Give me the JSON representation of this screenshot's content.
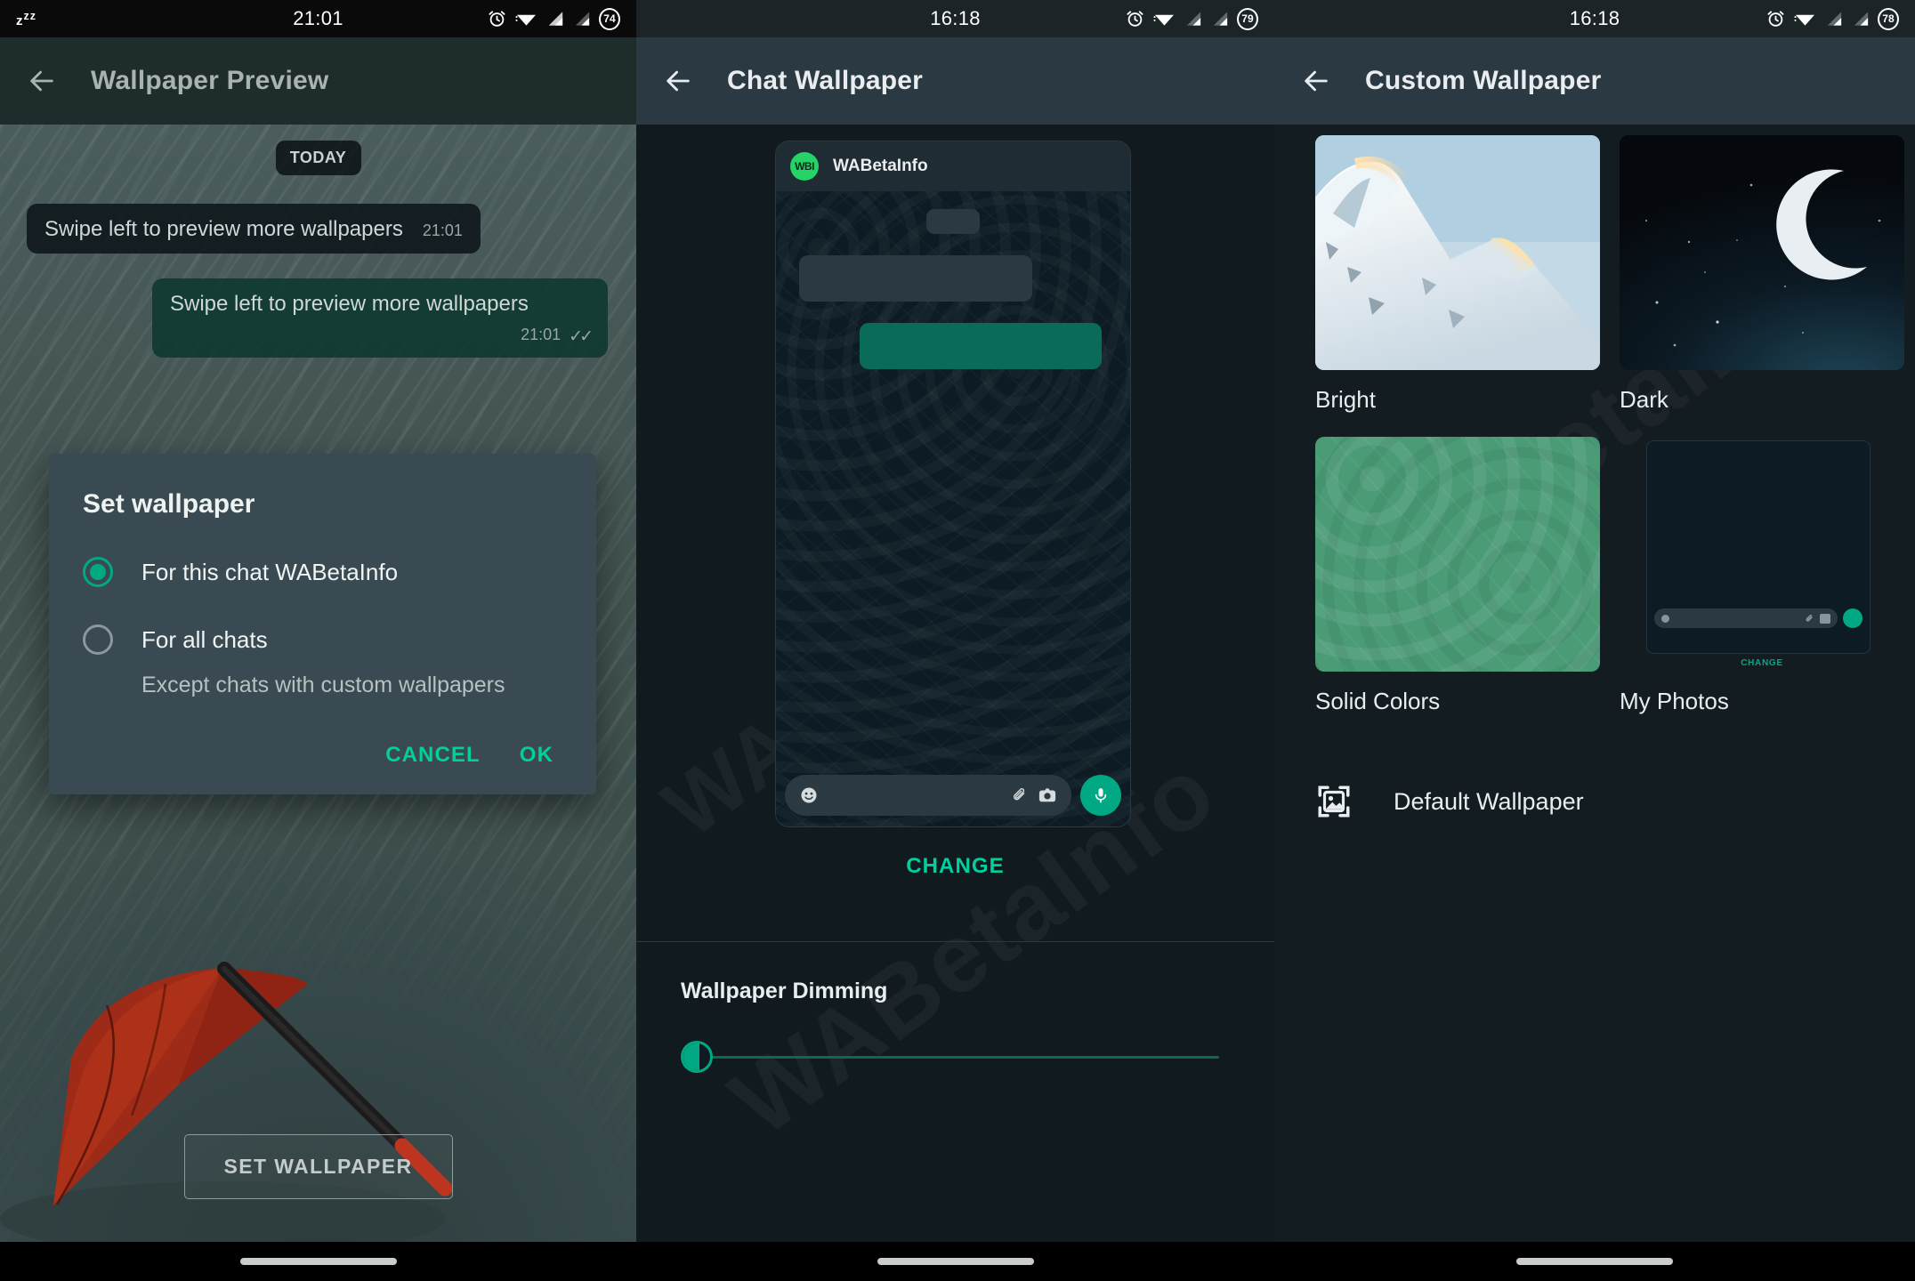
{
  "panels": [
    {
      "id": "wallpaper-preview",
      "statusbar": {
        "sleep_icon": "zzz-icon",
        "time": "21:01",
        "alarm_icon": "alarm-icon",
        "wifi_icon": "wifi-icon",
        "signal1_icon": "signal-icon",
        "signal2_icon": "signal-icon",
        "battery": "74"
      },
      "appbar": {
        "back_icon": "back-arrow-icon",
        "title": "Wallpaper Preview"
      },
      "chat": {
        "date_pill": "TODAY",
        "messages": [
          {
            "text": "Swipe left to preview more wallpapers",
            "time": "21:01",
            "direction": "incoming",
            "ticks": ""
          },
          {
            "text": "Swipe left to preview more wallpapers",
            "time": "21:01",
            "direction": "outgoing",
            "ticks": "✓✓"
          }
        ]
      },
      "dialog": {
        "title": "Set wallpaper",
        "options": [
          {
            "label": "For this chat WABetaInfo",
            "selected": true,
            "sub": ""
          },
          {
            "label": "For all chats",
            "selected": false,
            "sub": "Except chats with custom wallpapers"
          }
        ],
        "cancel_label": "CANCEL",
        "ok_label": "OK"
      },
      "set_wallpaper_label": "SET WALLPAPER",
      "wallpaper_art": "red-umbrella-in-rain"
    },
    {
      "id": "chat-wallpaper",
      "statusbar": {
        "time": "16:18",
        "alarm_icon": "alarm-icon",
        "wifi_icon": "wifi-icon",
        "signal1_icon": "signal-icon",
        "signal2_icon": "signal-icon",
        "battery": "79"
      },
      "appbar": {
        "back_icon": "back-arrow-icon",
        "title": "Chat Wallpaper"
      },
      "preview": {
        "contact_name": "WABetaInfo",
        "avatar_initials": "WBI",
        "input_icons": [
          "emoji-icon",
          "attach-icon",
          "camera-icon",
          "mic-icon"
        ]
      },
      "change_label": "CHANGE",
      "dimming": {
        "title": "Wallpaper Dimming",
        "slider_icon": "brightness-moon-icon",
        "value_percent": 0
      },
      "watermark": "WABetaInfo"
    },
    {
      "id": "custom-wallpaper",
      "statusbar": {
        "time": "16:18",
        "alarm_icon": "alarm-icon",
        "wifi_icon": "wifi-icon",
        "signal1_icon": "signal-icon",
        "signal2_icon": "signal-icon",
        "battery": "78"
      },
      "appbar": {
        "back_icon": "back-arrow-icon",
        "title": "Custom Wallpaper"
      },
      "options": [
        {
          "label": "Bright",
          "art": "snowy-mountain-peak"
        },
        {
          "label": "Dark",
          "art": "crescent-moon-night-sky"
        },
        {
          "label": "Solid Colors",
          "art": "green-doodle-pattern"
        },
        {
          "label": "My Photos",
          "art": "phone-preview-mockup",
          "inner_label": "CHANGE"
        }
      ],
      "default_row": {
        "icon": "image-placeholder-icon",
        "label": "Default Wallpaper"
      },
      "watermark": "WABetaInfo"
    }
  ],
  "colors": {
    "accent_green": "#00a884",
    "link_green": "#00d09c",
    "appbar_dark": "#2a3942",
    "dialog_bg": "#3a4a52",
    "outgoing_bubble": "#0b6b5b"
  }
}
